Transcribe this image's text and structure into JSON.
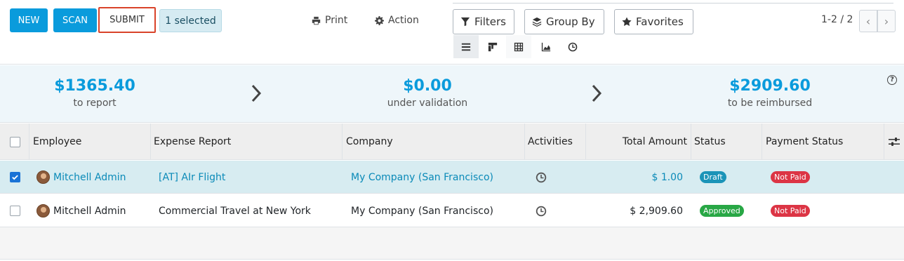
{
  "toolbar": {
    "new_label": "NEW",
    "scan_label": "SCAN",
    "submit_label": "SUBMIT",
    "selected_label": "1 selected",
    "print_label": "Print",
    "action_label": "Action"
  },
  "search": {
    "filters_label": "Filters",
    "groupby_label": "Group By",
    "favorites_label": "Favorites"
  },
  "pager": {
    "value": "1-2 / 2"
  },
  "summary": [
    {
      "amount": "$1365.40",
      "label": "to report"
    },
    {
      "amount": "$0.00",
      "label": "under validation"
    },
    {
      "amount": "$2909.60",
      "label": "to be reimbursed"
    }
  ],
  "table": {
    "columns": [
      "Employee",
      "Expense Report",
      "Company",
      "Activities",
      "Total Amount",
      "Status",
      "Payment Status"
    ],
    "rows": [
      {
        "selected": true,
        "employee": "Mitchell Admin",
        "report": "[AT] AIr Flight",
        "company": "My Company (San Francisco)",
        "amount": "$ 1.00",
        "status": "Draft",
        "payment": "Not Paid"
      },
      {
        "selected": false,
        "employee": "Mitchell Admin",
        "report": "Commercial Travel at New York",
        "company": "My Company (San Francisco)",
        "amount": "$ 2,909.60",
        "status": "Approved",
        "payment": "Not Paid"
      }
    ]
  },
  "colors": {
    "primary": "#0a9bdc",
    "highlight_border": "#d9432a",
    "selected_row": "#d7ecf1",
    "draft": "#1b94b8",
    "approved": "#28a745",
    "not_paid": "#dc3545"
  }
}
